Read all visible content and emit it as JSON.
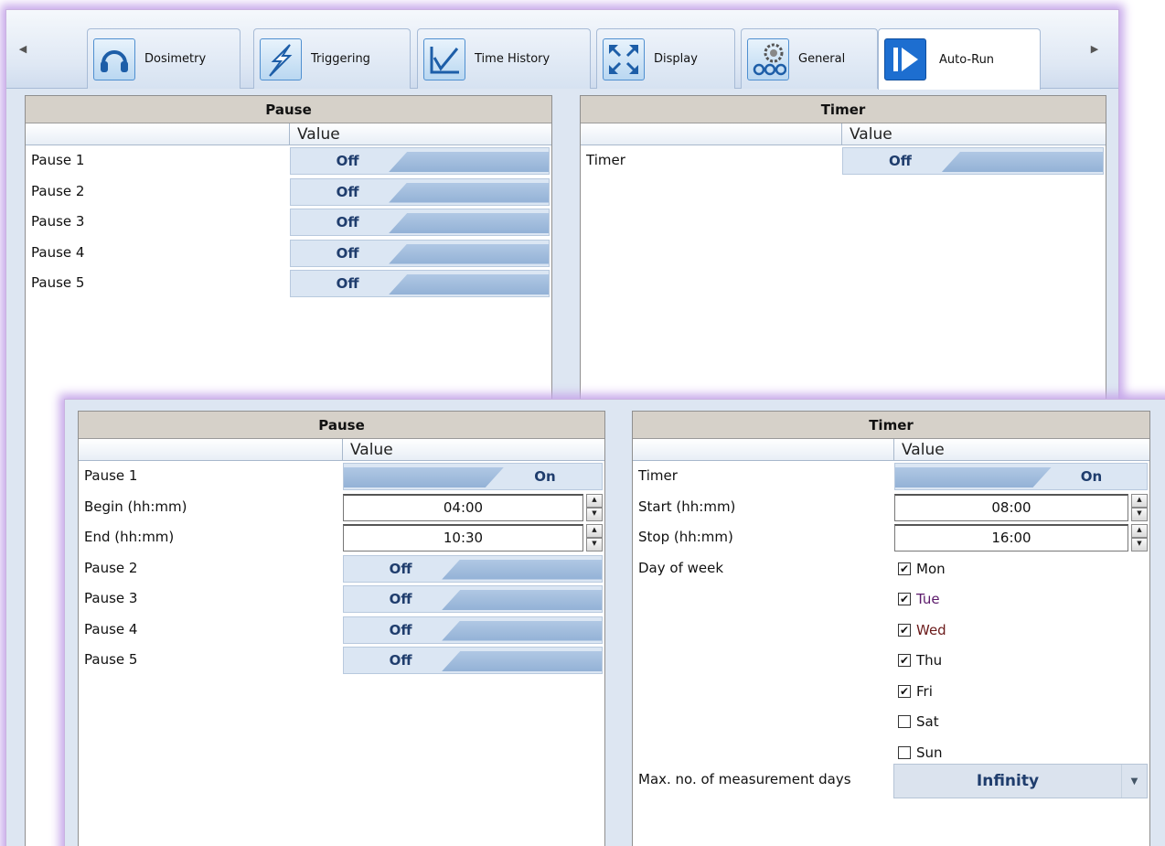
{
  "tabs": [
    {
      "label": "Dosimetry",
      "icon": "headphones-icon"
    },
    {
      "label": "Triggering",
      "icon": "lightning-icon"
    },
    {
      "label": "Time History",
      "icon": "chart-line-icon"
    },
    {
      "label": "Display",
      "icon": "expand-arrows-icon"
    },
    {
      "label": "General",
      "icon": "gears-icon"
    },
    {
      "label": "Auto-Run",
      "icon": "play-icon",
      "active": true
    }
  ],
  "back": {
    "pause": {
      "title": "Pause",
      "col_header": "Value",
      "rows": [
        {
          "label": "Pause 1",
          "value": "Off"
        },
        {
          "label": "Pause 2",
          "value": "Off"
        },
        {
          "label": "Pause 3",
          "value": "Off"
        },
        {
          "label": "Pause 4",
          "value": "Off"
        },
        {
          "label": "Pause 5",
          "value": "Off"
        }
      ]
    },
    "timer": {
      "title": "Timer",
      "col_header": "Value",
      "rows": [
        {
          "label": "Timer",
          "value": "Off"
        }
      ]
    }
  },
  "front": {
    "pause": {
      "title": "Pause",
      "col_header": "Value",
      "pause1": {
        "label": "Pause 1",
        "value": "On"
      },
      "begin": {
        "label": "Begin (hh:mm)",
        "value": "04:00"
      },
      "end": {
        "label": "End (hh:mm)",
        "value": "10:30"
      },
      "rows": [
        {
          "label": "Pause 2",
          "value": "Off"
        },
        {
          "label": "Pause 3",
          "value": "Off"
        },
        {
          "label": "Pause 4",
          "value": "Off"
        },
        {
          "label": "Pause 5",
          "value": "Off"
        }
      ]
    },
    "timer": {
      "title": "Timer",
      "col_header": "Value",
      "timer": {
        "label": "Timer",
        "value": "On"
      },
      "start": {
        "label": "Start (hh:mm)",
        "value": "08:00"
      },
      "stop": {
        "label": "Stop (hh:mm)",
        "value": "16:00"
      },
      "day_of_week_label": "Day of week",
      "days": [
        {
          "label": "Mon",
          "checked": true,
          "color": "#111111"
        },
        {
          "label": "Tue",
          "checked": true,
          "color": "#5c1a6b"
        },
        {
          "label": "Wed",
          "checked": true,
          "color": "#6b1a1a"
        },
        {
          "label": "Thu",
          "checked": true,
          "color": "#111111"
        },
        {
          "label": "Fri",
          "checked": true,
          "color": "#111111"
        },
        {
          "label": "Sat",
          "checked": false,
          "color": "#111111"
        },
        {
          "label": "Sun",
          "checked": false,
          "color": "#111111"
        }
      ],
      "max_days_label": "Max. no. of measurement days",
      "max_days_value": "Infinity"
    }
  },
  "colors": {
    "accent": "#1f3d6d",
    "toggle_slab": "#93b2d6",
    "frame_glow": "#c7a8ea"
  }
}
